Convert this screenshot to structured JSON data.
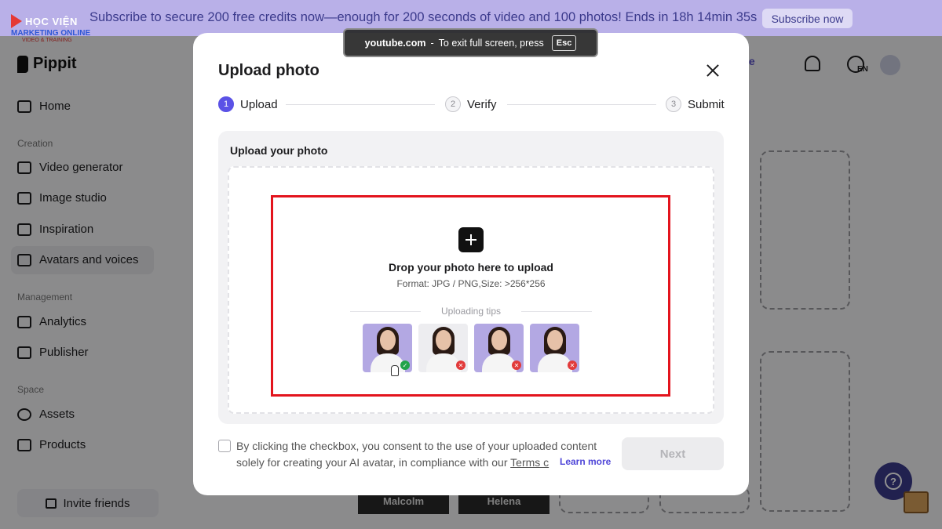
{
  "banner": {
    "text": "Subscribe to secure 200 free credits now—enough for 200 seconds of video and 100 photos! Ends in 18h 14min 35s",
    "button": "Subscribe now"
  },
  "watermark": {
    "line1": "HỌC VIỆN",
    "line2": "MARKETING ONLINE",
    "line3": "VIDEO & TRAINING"
  },
  "app": {
    "name": "Pippit",
    "subscribe_partial": "ribe",
    "lang": "EN"
  },
  "sidebar": {
    "home": "Home",
    "creation_label": "Creation",
    "creation": [
      "Video generator",
      "Image studio",
      "Inspiration",
      "Avatars and voices"
    ],
    "management_label": "Management",
    "management": [
      "Analytics",
      "Publisher"
    ],
    "space_label": "Space",
    "space": [
      "Assets",
      "Products"
    ],
    "invite": "Invite friends"
  },
  "background_cards": [
    "Malcolm",
    "Helena"
  ],
  "fullscreen_notice": {
    "site": "youtube.com",
    "message": "To exit full screen, press",
    "key": "Esc"
  },
  "modal": {
    "title": "Upload photo",
    "steps": [
      {
        "num": "1",
        "label": "Upload",
        "active": true
      },
      {
        "num": "2",
        "label": "Verify",
        "active": false
      },
      {
        "num": "3",
        "label": "Submit",
        "active": false
      }
    ],
    "panel_heading": "Upload your photo",
    "drop_title": "Drop your photo here to upload",
    "drop_format": "Format: JPG / PNG,Size: >256*256",
    "tips_label": "Uploading tips",
    "tips": [
      {
        "status": "ok",
        "symbol": "✓"
      },
      {
        "status": "bad",
        "symbol": "✕"
      },
      {
        "status": "bad",
        "symbol": "✕"
      },
      {
        "status": "bad",
        "symbol": "✕"
      }
    ],
    "consent_text": "By clicking the checkbox, you consent to the use of your uploaded content solely for creating your AI avatar, in compliance with our",
    "consent_link": "Terms c",
    "learn_more": "Learn more",
    "next": "Next"
  },
  "colors": {
    "accent": "#5b52e6",
    "banner_bg": "#b9b0e8",
    "highlight": "#e3141d"
  }
}
